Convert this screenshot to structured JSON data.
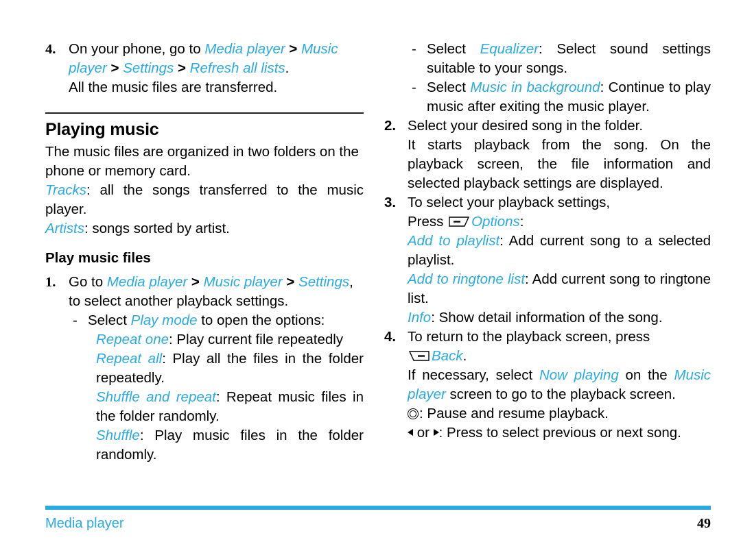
{
  "page": {
    "number": "49",
    "footer_section": "Media player",
    "accent_color": "#29ABE2",
    "rule_color": "#231f20"
  },
  "left_column": {
    "step4": {
      "number": "4.",
      "line1_a": "On your phone, go to ",
      "line1_nav1": "Media player",
      "sep1": " > ",
      "line1_nav2": "Music player",
      "sep2": " > ",
      "line1_nav3": "Settings",
      "sep3": " > ",
      "line1_nav4": "Refresh all lists",
      "line1_end": ".",
      "line2": "All the music files are transferred."
    },
    "heading": "Playing music",
    "intro": "The music files are organized in two folders on the phone or memory card.",
    "tracks_label": "Tracks",
    "tracks_desc": ": all the songs transferred to the music player.",
    "artists_label": "Artists",
    "artists_desc": ": songs sorted by artist.",
    "subheading": "Play music files",
    "step1": {
      "number": "1.",
      "text_a": "Go to ",
      "nav1": "Media player",
      "sep1": " > ",
      "nav2": "Music player",
      "sep2": " > ",
      "nav3": "Settings",
      "text_b": ", to select another playback settings."
    },
    "play_mode_bullet": {
      "dash": "-",
      "text_a": "Select ",
      "label": "Play mode",
      "text_b": " to open the options:"
    },
    "options": [
      {
        "label": "Repeat one",
        "desc": ": Play current file repeatedly"
      },
      {
        "label": "Repeat all",
        "desc": ": Play all the files in the folder repeatedly."
      },
      {
        "label": "Shuffle and repeat",
        "desc": ": Repeat music files in the folder randomly."
      },
      {
        "label": "Shuffle",
        "desc": ": Play music files in the folder randomly."
      }
    ]
  },
  "right_column": {
    "equalizer_bullet": {
      "dash": "-",
      "text_a": "Select ",
      "label": "Equalizer",
      "text_b": ": Select sound settings suitable to your songs."
    },
    "background_bullet": {
      "dash": "-",
      "text_a": "Select ",
      "label": "Music in background",
      "text_b": ": Continue to play music after exiting the music player."
    },
    "step2": {
      "number": "2.",
      "line1": "Select your desired song in the folder.",
      "line2": "It starts playback from the song. On the playback screen, the file information and selected playback settings are displayed."
    },
    "step3": {
      "number": "3.",
      "line1": "To select your playback settings,",
      "press_text": "Press ",
      "softkey_icon": "left-softkey-icon",
      "options_label": "Options",
      "colon": ":"
    },
    "option_items": [
      {
        "label": "Add to playlist",
        "desc": ": Add current song to a selected playlist."
      },
      {
        "label": "Add to ringtone list",
        "desc": ": Add current song to ringtone list."
      },
      {
        "label": "Info",
        "desc": ": Show detail information of the song."
      }
    ],
    "step4": {
      "number": "4.",
      "text_a": "To return to the playback screen, press ",
      "softkey_icon": "right-softkey-icon",
      "back_label": "Back",
      "text_b": "."
    },
    "now_playing": {
      "text_a": "If necessary, select ",
      "label1": "Now playing",
      "text_b": " on the ",
      "label2": "Music player",
      "text_c": " screen to go to the playback screen."
    },
    "pause_line": {
      "icon": "center-select-key-icon",
      "text": ": Pause and resume playback."
    },
    "nav_line": {
      "left_icon": "left-arrow-key-icon",
      "or_text": " or ",
      "right_icon": "right-arrow-key-icon",
      "text": ": Press to select previous or next song."
    }
  }
}
